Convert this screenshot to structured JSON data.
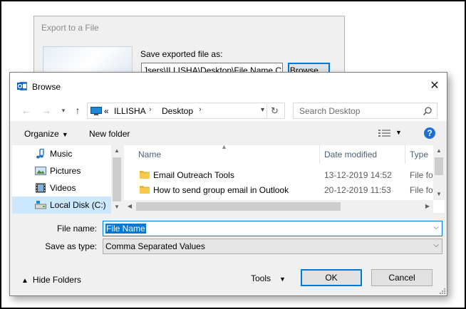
{
  "background_dialog": {
    "title": "Export to a File",
    "save_label": "Save exported file as:",
    "path_value": "Jsers\\ILLISHA\\Desktop\\File Name.CSV",
    "browse_label": "Browse ..."
  },
  "dialog": {
    "title": "Browse",
    "close_glyph": "✕"
  },
  "navigation": {
    "back_glyph": "←",
    "forward_glyph": "→",
    "up_glyph": "↑",
    "breadcrumb_prefix": "«",
    "breadcrumbs": [
      "ILLISHA",
      "Desktop"
    ],
    "chevron": "›",
    "refresh_glyph": "↻",
    "search_placeholder": "Search Desktop"
  },
  "toolbar": {
    "organize_label": "Organize",
    "new_folder_label": "New folder",
    "help_glyph": "?"
  },
  "nav_pane": {
    "items": [
      {
        "label": "Music",
        "icon": "music-icon",
        "selected": false
      },
      {
        "label": "Pictures",
        "icon": "pictures-icon",
        "selected": false
      },
      {
        "label": "Videos",
        "icon": "videos-icon",
        "selected": false
      },
      {
        "label": "Local Disk (C:)",
        "icon": "drive-icon",
        "selected": true
      }
    ]
  },
  "file_list": {
    "columns": [
      "Name",
      "Date modified",
      "Type"
    ],
    "rows": [
      {
        "name": "Email Outreach Tools",
        "date": "13-12-2019 14:52",
        "type": "File fol"
      },
      {
        "name": "How to send group email in Outlook",
        "date": "20-12-2019 11:53",
        "type": "File fol"
      }
    ]
  },
  "form": {
    "file_name_label": "File name:",
    "file_name_value": "File Name",
    "save_as_type_label": "Save as type:",
    "save_as_type_value": "Comma Separated Values"
  },
  "footer": {
    "hide_folders_label": "Hide Folders",
    "tools_label": "Tools",
    "ok_label": "OK",
    "cancel_label": "Cancel"
  },
  "colors": {
    "accent": "#0078d7",
    "selection": "#cce8ff",
    "folder": "#f6c94a"
  }
}
